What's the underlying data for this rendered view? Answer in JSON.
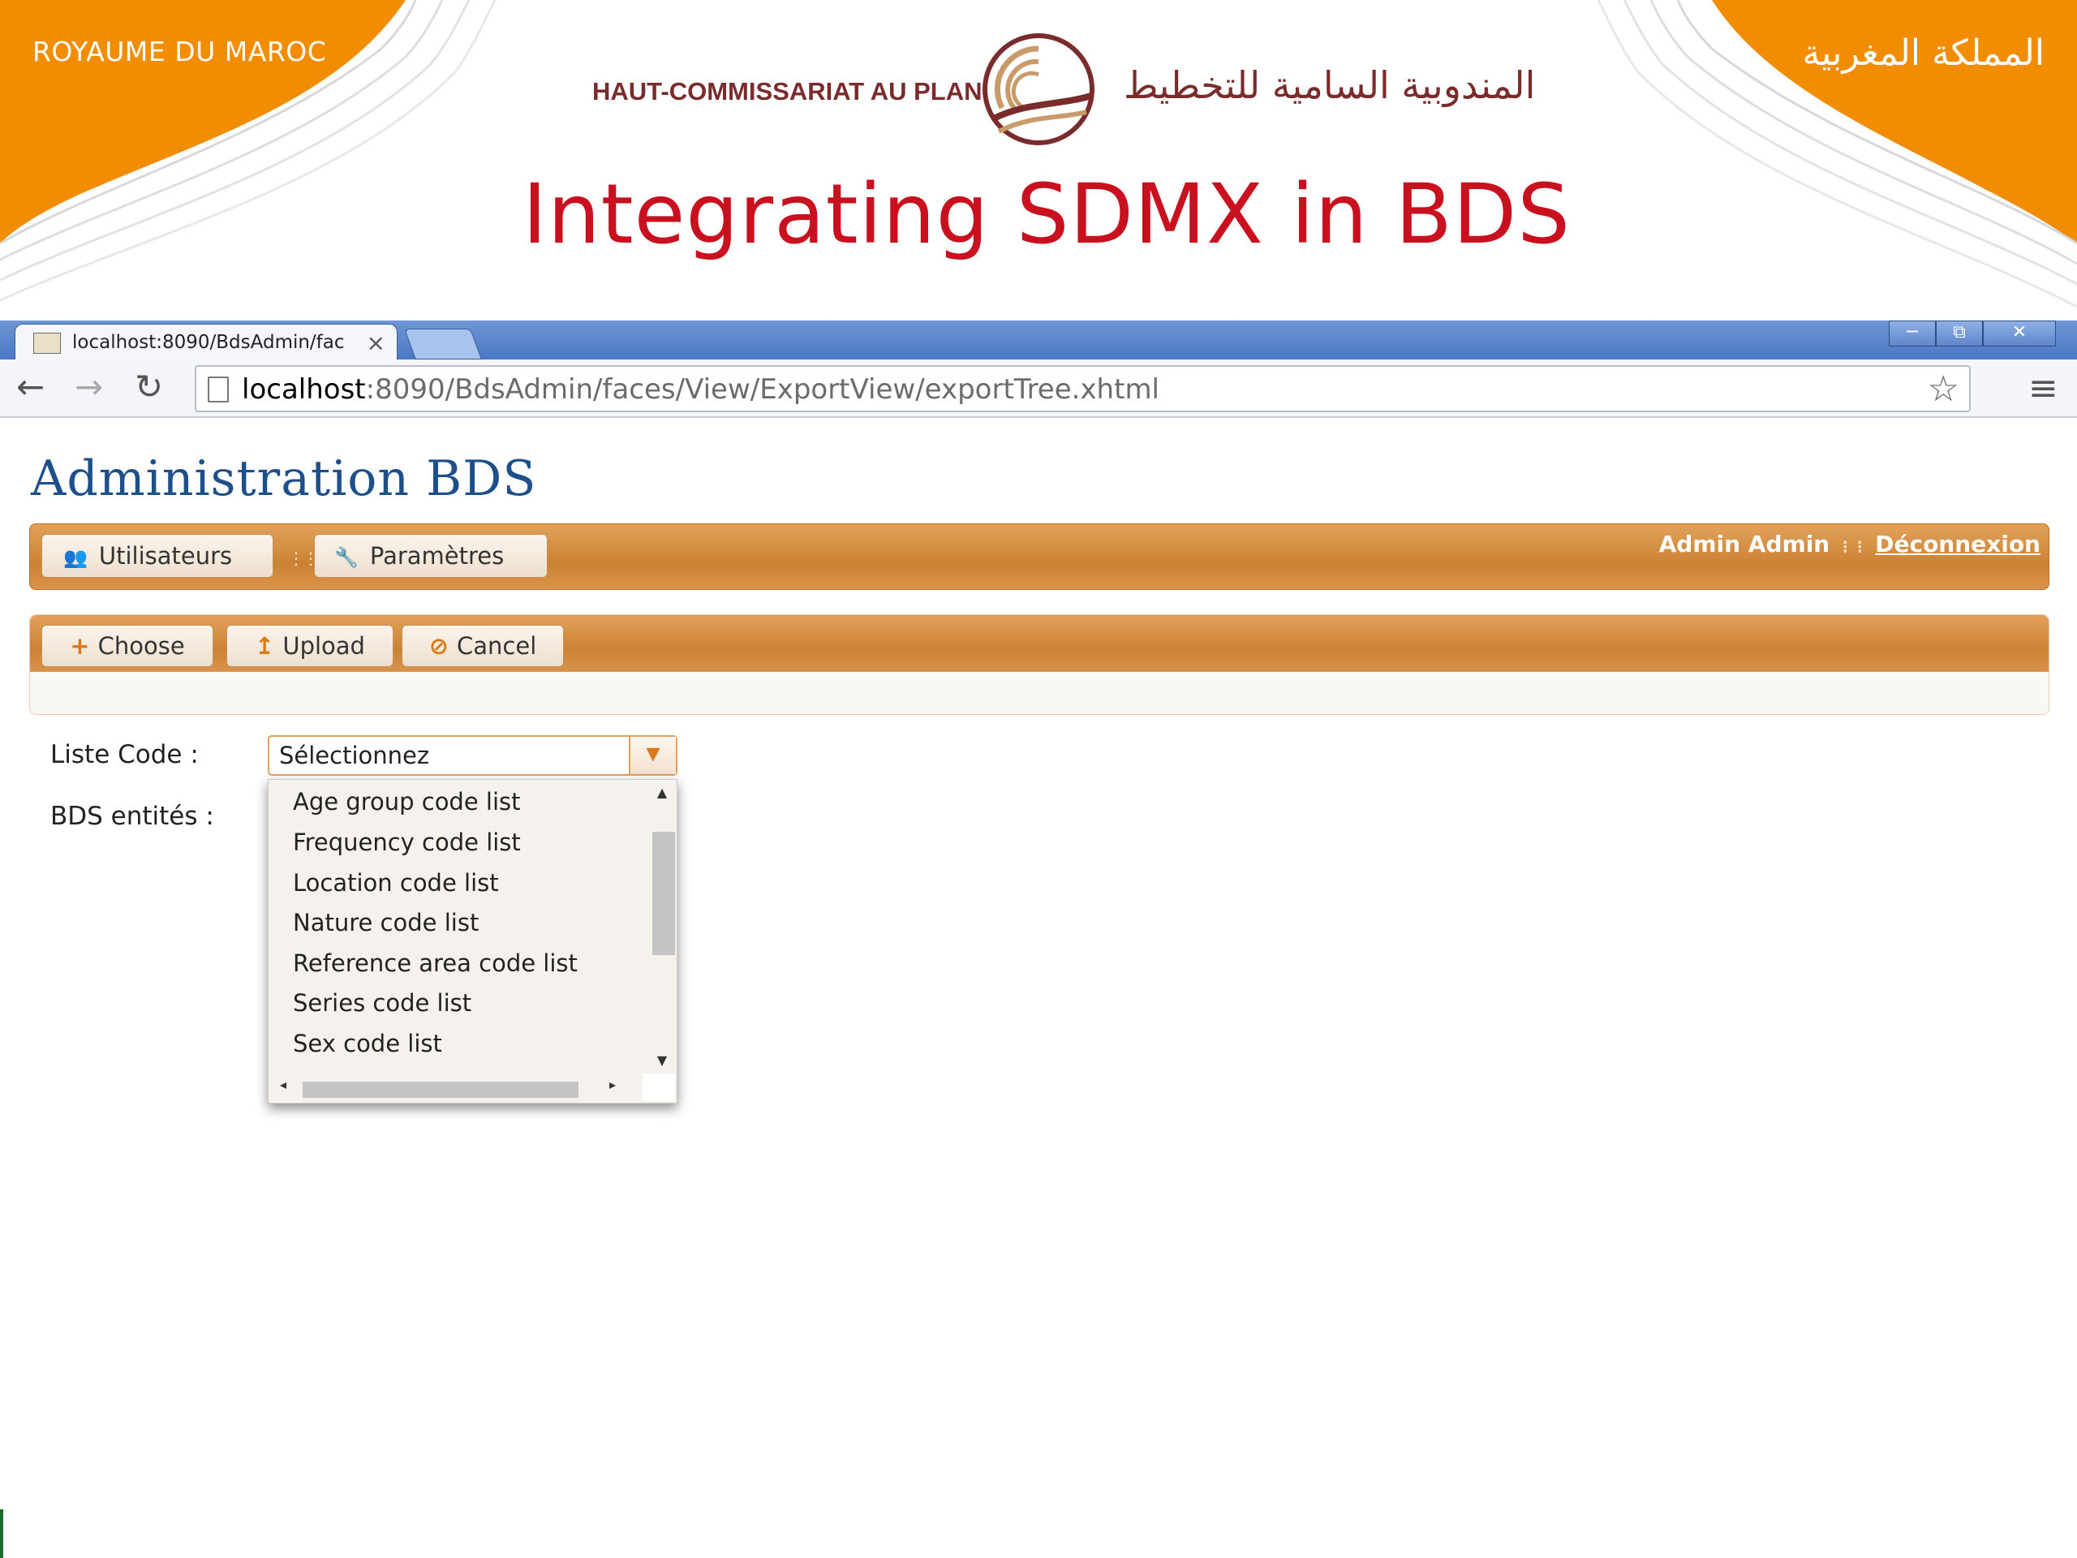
{
  "slide": {
    "kingdom_fr": "ROYAUME DU MAROC",
    "kingdom_ar": "المملكة المغربية",
    "institution_fr": "HAUT-COMMISSARIAT AU PLAN",
    "institution_ar": "المندوبية السامية للتخطيط",
    "title": "Integrating SDMX in BDS",
    "colors": {
      "orange": "#f28c00",
      "title_red": "#c8101e",
      "maroon": "#7a2b2b"
    }
  },
  "browser": {
    "tab_title": "localhost:8090/BdsAdmin/fac",
    "url_host": "localhost",
    "url_rest": ":8090/BdsAdmin/faces/View/ExportView/exportTree.xhtml",
    "window_controls": [
      "─",
      "⧉",
      "✕"
    ]
  },
  "app": {
    "title": "Administration BDS",
    "menu": {
      "items": [
        {
          "label": "Utilisateurs",
          "icon": "users-icon"
        },
        {
          "label": "Paramètres",
          "icon": "wrench-icon"
        }
      ],
      "user_name": "Admin Admin",
      "logout_label": "Déconnexion"
    },
    "upload": {
      "choose_label": "Choose",
      "upload_label": "Upload",
      "cancel_label": "Cancel"
    },
    "form": {
      "liste_code_label": "Liste Code :",
      "bds_entites_label": "BDS entités :",
      "select_value": "Sélectionnez",
      "options": [
        "Age group code list",
        "Frequency code list",
        "Location code list",
        "Nature code list",
        "Reference area code list",
        "Series code list",
        "Sex code list"
      ]
    }
  }
}
